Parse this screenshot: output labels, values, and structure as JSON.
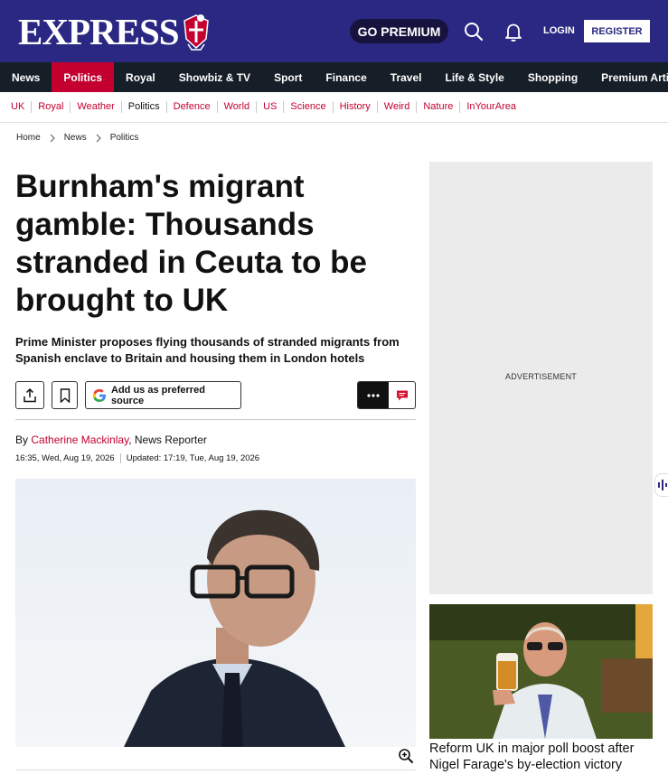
{
  "header": {
    "logo_text": "EXPRESS",
    "premium_label": "GO PREMIUM",
    "login_label": "LOGIN",
    "register_label": "REGISTER"
  },
  "main_nav": [
    {
      "label": "News",
      "active": false
    },
    {
      "label": "Politics",
      "active": true
    },
    {
      "label": "Royal",
      "active": false
    },
    {
      "label": "Showbiz & TV",
      "active": false
    },
    {
      "label": "Sport",
      "active": false
    },
    {
      "label": "Finance",
      "active": false
    },
    {
      "label": "Travel",
      "active": false
    },
    {
      "label": "Life & Style",
      "active": false
    },
    {
      "label": "Shopping",
      "active": false
    },
    {
      "label": "Premium Articles",
      "active": false
    }
  ],
  "sub_nav": [
    {
      "label": "UK",
      "current": false
    },
    {
      "label": "Royal",
      "current": false
    },
    {
      "label": "Weather",
      "current": false
    },
    {
      "label": "Politics",
      "current": true
    },
    {
      "label": "Defence",
      "current": false
    },
    {
      "label": "World",
      "current": false
    },
    {
      "label": "US",
      "current": false
    },
    {
      "label": "Science",
      "current": false
    },
    {
      "label": "History",
      "current": false
    },
    {
      "label": "Weird",
      "current": false
    },
    {
      "label": "Nature",
      "current": false
    },
    {
      "label": "InYourArea",
      "current": false
    }
  ],
  "breadcrumb": [
    "Home",
    "News",
    "Politics"
  ],
  "article": {
    "headline": "Burnham's migrant gamble: Thousands stranded in Ceuta to be brought to UK",
    "standfirst": "Prime Minister proposes flying thousands of stranded migrants from Spanish enclave to Britain and housing them in London hotels",
    "google_source_label": "Add us as preferred source",
    "byline_prefix": "By",
    "author": "Catherine Mackinlay",
    "author_role": ", News Reporter",
    "published": "16:35, Wed, Aug 19, 2026",
    "updated": "Updated: 17:19, Tue, Aug 19, 2026"
  },
  "sidebar": {
    "ad_label": "ADVERTISEMENT",
    "promo_title": "Reform UK in major poll boost after Nigel Farage's by-election victory"
  },
  "colors": {
    "brand_blue": "#2b2883",
    "nav_dark": "#161e27",
    "accent_red": "#c3002f"
  },
  "icons": [
    "crest-logo-icon",
    "search-icon",
    "bell-icon",
    "share-icon",
    "bookmark-icon",
    "google-icon",
    "more-dots-icon",
    "comment-icon",
    "zoom-in-icon",
    "audio-bars-icon"
  ]
}
